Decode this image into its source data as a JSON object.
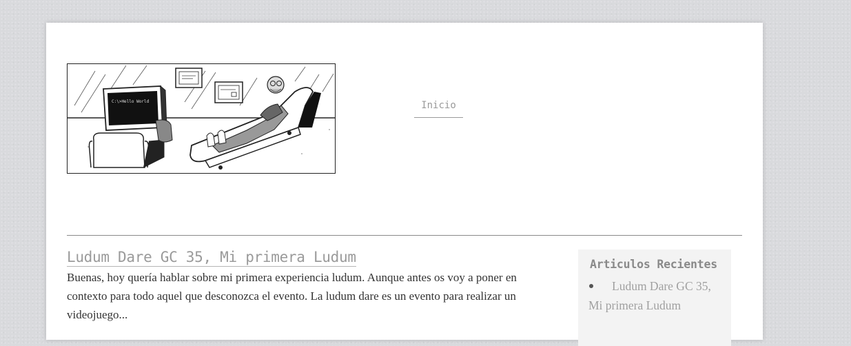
{
  "site": {
    "header_image": "comic-illustration-therapist-computer-on-couch",
    "screen_text": "C:\\>Hello World"
  },
  "nav": {
    "items": [
      {
        "label": "Inicio"
      }
    ]
  },
  "post": {
    "title": "Ludum Dare GC 35, Mi primera Ludum",
    "excerpt": "Buenas, hoy quería hablar sobre mi primera experiencia ludum. Aunque antes os voy a poner en contexto para todo aquel que desconozca el evento. La ludum dare es un evento para realizar un videojuego..."
  },
  "sidebar": {
    "widget_title": "Articulos Recientes",
    "recent_posts": [
      {
        "label": "Ludum Dare GC 35, Mi primera Ludum"
      }
    ]
  },
  "colors": {
    "background": "#d9dadd",
    "page": "#ffffff",
    "link_gray": "#9a9a9a",
    "sidebar_bg": "#f3f3f3"
  }
}
